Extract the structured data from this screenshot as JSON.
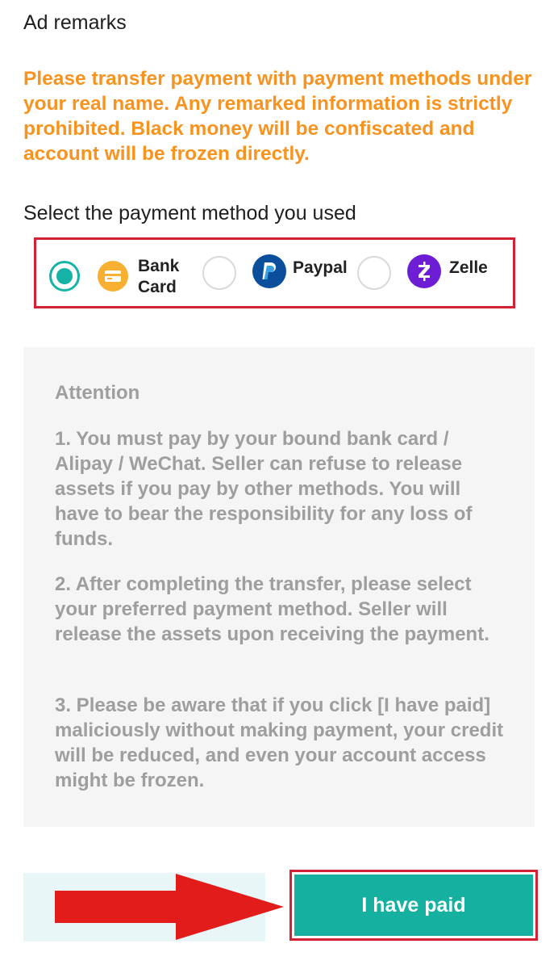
{
  "ad_remarks": {
    "title": "Ad remarks",
    "warning": "Please transfer payment with payment methods under your real name. Any remarked information is strictly prohibited. Black money will be confiscated and account will be frozen directly."
  },
  "payment_method": {
    "title": "Select the payment method you used",
    "options": [
      {
        "label_line1": "Bank",
        "label_line2": "Card",
        "icon": "bank-card-icon",
        "icon_color": "#f7b032",
        "selected": true
      },
      {
        "label": "Paypal",
        "icon": "paypal-icon",
        "icon_color": "#0b4f9c",
        "selected": false
      },
      {
        "label": "Zelle",
        "icon": "zelle-icon",
        "icon_color": "#6d1ed4",
        "selected": false
      }
    ]
  },
  "attention": {
    "title": "Attention",
    "items": [
      "1. You must pay by your bound bank card / Alipay / WeChat. Seller can refuse to release assets if you pay by other methods. You will have to bear the responsibility for any loss of funds.",
      "2. After completing the transfer, please select your preferred payment method. Seller will release the assets upon receiving the payment.",
      "3. Please be aware that if you click [I have paid] maliciously without making payment, your credit will be reduced, and even your account access might be frozen."
    ]
  },
  "actions": {
    "paid_label": "I have paid"
  },
  "colors": {
    "warning": "#f7931e",
    "accent": "#15b09f",
    "highlight_border": "#d32032",
    "arrow": "#e21b1b"
  }
}
